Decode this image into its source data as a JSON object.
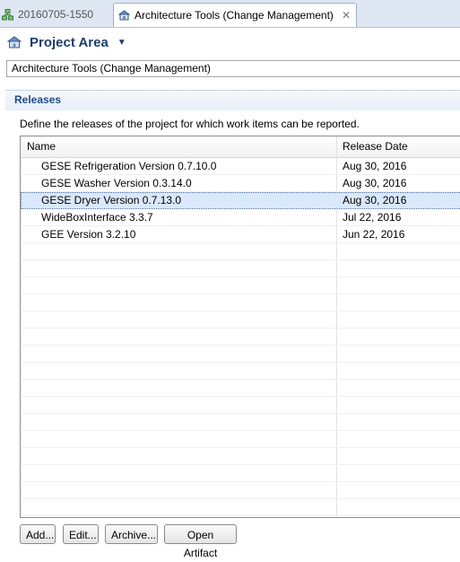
{
  "tabs": [
    {
      "label": "20160705-1550",
      "icon": "build-icon",
      "active": false
    },
    {
      "label": "Architecture Tools (Change Management)",
      "icon": "project-area-icon",
      "active": true
    }
  ],
  "header": {
    "title": "Project Area",
    "menu_icon": "chevron-down-icon"
  },
  "project_name": "Architecture Tools (Change Management)",
  "releases": {
    "section_title": "Releases",
    "description": "Define the releases of the project for which work items can be reported.",
    "columns": [
      "Name",
      "Release Date"
    ],
    "rows": [
      {
        "name": "GESE Refrigeration Version 0.7.10.0",
        "date": "Aug 30, 2016",
        "selected": false
      },
      {
        "name": "GESE Washer Version 0.3.14.0",
        "date": "Aug 30, 2016",
        "selected": false
      },
      {
        "name": "GESE Dryer Version 0.7.13.0",
        "date": "Aug 30, 2016",
        "selected": true
      },
      {
        "name": "WideBoxInterface 3.3.7",
        "date": "Jul 22, 2016",
        "selected": false
      },
      {
        "name": "GEE Version 3.2.10",
        "date": "Jun 22, 2016",
        "selected": false
      }
    ]
  },
  "buttons": {
    "add": "Add...",
    "edit": "Edit...",
    "archive": "Archive...",
    "open_artifact": "Open Artifact"
  },
  "colors": {
    "title": "#1f3d6d",
    "selection": "#d9e8fb",
    "tab_strip": "#dfe7f2"
  }
}
